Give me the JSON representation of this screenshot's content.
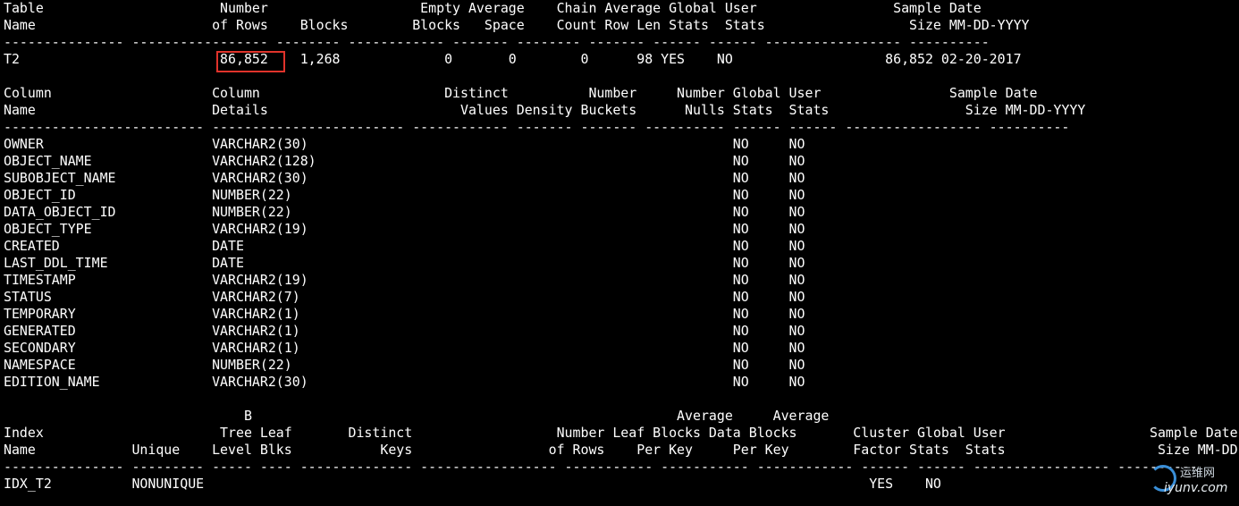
{
  "terminal": {
    "lines": [
      "Table                      Number                   Empty Average    Chain Average Global User                 Sample Date",
      "Name                      of Rows    Blocks        Blocks   Space    Count Row Len Stats  Stats                  Size MM-DD-YYYY",
      "--------------- ----------------- -------- ------------ ------- -------- ------- ------ ------ ----------------- ----------",
      "T2                         86,852    1,268             0       0        0      98 YES    NO                   86,852 02-20-2017",
      "",
      "Column                    Column                       Distinct          Number     Number Global User                Sample Date",
      "Name                      Details                        Values Density Buckets      Nulls Stats  Stats                 Size MM-DD-YYYY",
      "------------------------- ------------------------ ------------ ------- ------- ---------- ------ ------ ----------------- ----------",
      "OWNER                     VARCHAR2(30)                                                     NO     NO",
      "OBJECT_NAME               VARCHAR2(128)                                                    NO     NO",
      "SUBOBJECT_NAME            VARCHAR2(30)                                                     NO     NO",
      "OBJECT_ID                 NUMBER(22)                                                       NO     NO",
      "DATA_OBJECT_ID            NUMBER(22)                                                       NO     NO",
      "OBJECT_TYPE               VARCHAR2(19)                                                     NO     NO",
      "CREATED                   DATE                                                             NO     NO",
      "LAST_DDL_TIME             DATE                                                             NO     NO",
      "TIMESTAMP                 VARCHAR2(19)                                                     NO     NO",
      "STATUS                    VARCHAR2(7)                                                      NO     NO",
      "TEMPORARY                 VARCHAR2(1)                                                      NO     NO",
      "GENERATED                 VARCHAR2(1)                                                      NO     NO",
      "SECONDARY                 VARCHAR2(1)                                                      NO     NO",
      "NAMESPACE                 NUMBER(22)                                                       NO     NO",
      "EDITION_NAME              VARCHAR2(30)                                                     NO     NO",
      "",
      "                              B                                                     Average     Average",
      "Index                      Tree Leaf       Distinct                  Number Leaf Blocks Data Blocks       Cluster Global User                  Sample Date",
      "Name            Unique    Level Blks           Keys                 of Rows    Per Key     Per Key        Factor Stats  Stats                   Size MM-DD-YYYY",
      "--------------- --------- ----- ---- -------------- ----------------- ----------- ----------- ------------ ------ ------ ----------------- ----------",
      "IDX_T2          NONUNIQUE                                                                                   YES    NO"
    ]
  },
  "watermark": {
    "cn_text": "运维网",
    "en_text": "iyunv.com"
  },
  "highlight_color": "#e0332b"
}
